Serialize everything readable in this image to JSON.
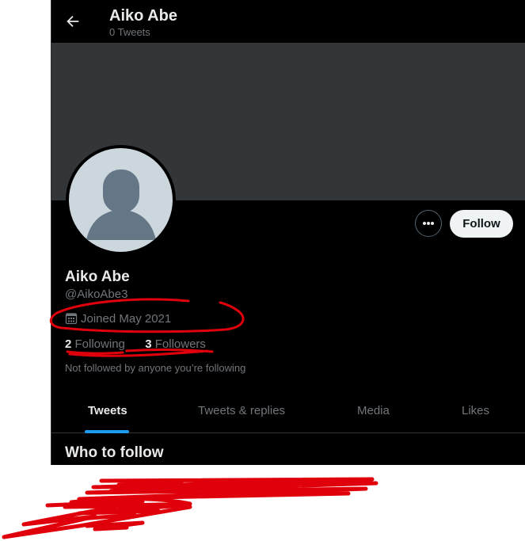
{
  "header": {
    "title": "Aiko Abe",
    "tweet_count": "0 Tweets",
    "back_icon": "arrow-left-icon"
  },
  "profile": {
    "name": "Aiko Abe",
    "handle": "@AikoAbe3",
    "joined": "Joined May 2021",
    "following_count": "2",
    "following_label": "Following",
    "followers_count": "3",
    "followers_label": "Followers",
    "not_followed": "Not followed by anyone you’re following"
  },
  "actions": {
    "more_icon": "more-dots-icon",
    "follow_label": "Follow"
  },
  "tabs": [
    {
      "label": "Tweets",
      "active": true
    },
    {
      "label": "Tweets & replies",
      "active": false
    },
    {
      "label": "Media",
      "active": false
    },
    {
      "label": "Likes",
      "active": false
    }
  ],
  "section": {
    "who_to_follow": "Who to follow"
  },
  "colors": {
    "background": "#000000",
    "banner": "#333639",
    "accent": "#1d9bf0",
    "annotation": "#e0000b"
  }
}
